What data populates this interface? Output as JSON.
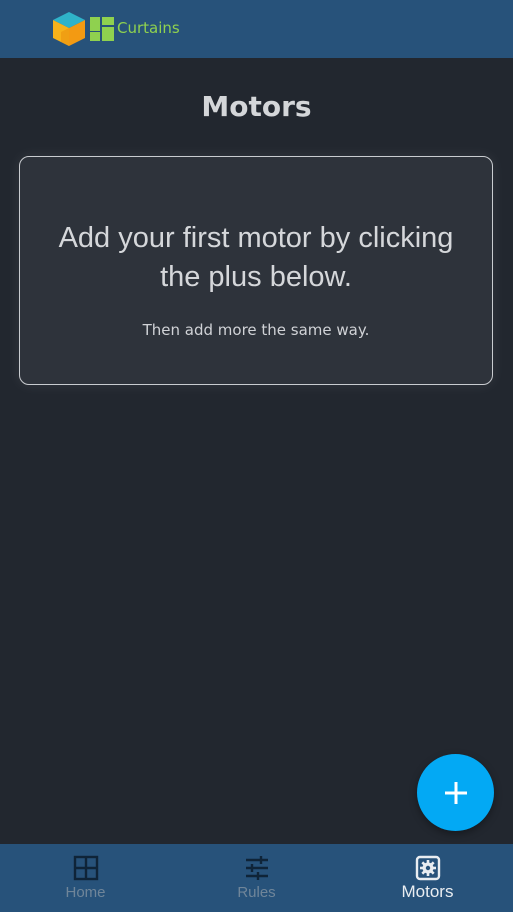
{
  "header": {
    "brand_name": "Curtains"
  },
  "page": {
    "title": "Motors"
  },
  "empty_state": {
    "heading": "Add your first motor by clicking the plus below.",
    "subtext": "Then add more the same way."
  },
  "fab": {
    "icon": "plus-icon"
  },
  "bottom_nav": {
    "items": [
      {
        "label": "Home",
        "icon": "grid-icon",
        "active": false
      },
      {
        "label": "Rules",
        "icon": "sliders-icon",
        "active": false
      },
      {
        "label": "Motors",
        "icon": "motor-gear-icon",
        "active": true
      }
    ]
  },
  "colors": {
    "header_bg": "#27527a",
    "page_bg": "#22272f",
    "card_bg": "#2e333b",
    "fab_bg": "#03a9f4",
    "brand_green": "#8fd14f",
    "nav_inactive": "#6f8599",
    "nav_active": "#e9edf1"
  }
}
